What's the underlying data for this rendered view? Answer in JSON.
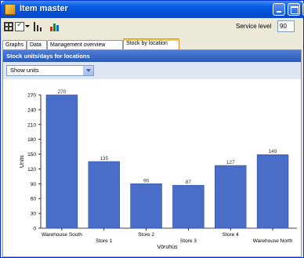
{
  "window": {
    "title": "Item master"
  },
  "toolbar": {
    "icons": [
      "grid-icon",
      "checkbox-icon",
      "dropdown-caret-icon",
      "bars-icon",
      "chart-icon"
    ],
    "service_level_label": "Service level",
    "service_level_value": "90"
  },
  "tabs": [
    {
      "label": "Graphs"
    },
    {
      "label": "Data"
    },
    {
      "label": "Management overview"
    },
    {
      "label": "Stock by location",
      "active": true
    }
  ],
  "section": {
    "title": "Stock units/days for locations"
  },
  "dropdown": {
    "selected": "Show units"
  },
  "chart_data": {
    "type": "bar",
    "categories": [
      "Warehouse South",
      "Store 1",
      "Store 2",
      "Store 3",
      "Store 4",
      "Warehouse North"
    ],
    "values": [
      270,
      135,
      90,
      87,
      127,
      149
    ],
    "data_labels": [
      "270",
      "135",
      "90",
      "87",
      "127",
      "149"
    ],
    "xlabel": "Vöruhús",
    "ylabel": "Units",
    "ylim": [
      0,
      270
    ],
    "yticks": [
      "0",
      "30",
      "60",
      "90",
      "120",
      "150",
      "180",
      "210",
      "240",
      "270"
    ],
    "grid": false,
    "bar_color": "#4a6ec8"
  }
}
